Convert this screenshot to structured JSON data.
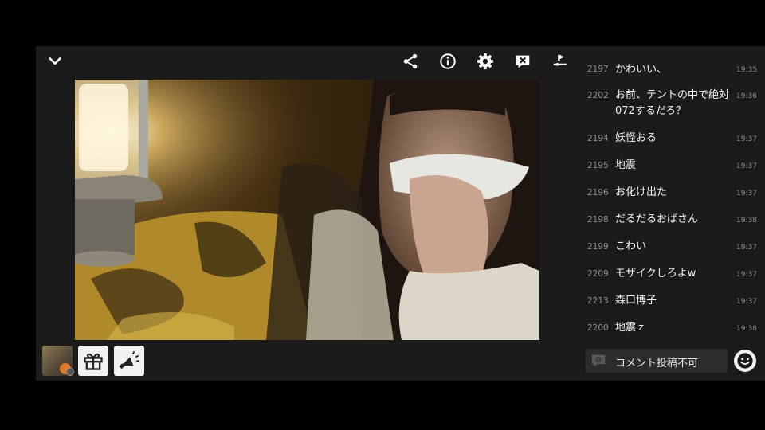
{
  "toolbar": {
    "collapse_icon": "chevron-down-icon",
    "share_icon": "share-icon",
    "info_icon": "info-icon",
    "settings_icon": "gear-icon",
    "close_icon": "close-box-icon",
    "exit_icon": "exit-icon"
  },
  "comments": [
    {
      "num": "2197",
      "text": "かわいい、",
      "time": "19:35"
    },
    {
      "num": "2202",
      "text": "お前、テントの中で絶対072するだろ？",
      "time": "19:36"
    },
    {
      "num": "2194",
      "text": "妖怪おる",
      "time": "19:37"
    },
    {
      "num": "2195",
      "text": "地震",
      "time": "19:37"
    },
    {
      "num": "2196",
      "text": "お化け出た",
      "time": "19:37"
    },
    {
      "num": "2198",
      "text": "だるだるおばさん",
      "time": "19:38"
    },
    {
      "num": "2199",
      "text": "こわい",
      "time": "19:37"
    },
    {
      "num": "2209",
      "text": "モザイクしろよw",
      "time": "19:37"
    },
    {
      "num": "2213",
      "text": "森口博子",
      "time": "19:37"
    },
    {
      "num": "2200",
      "text": "地震ｚ",
      "time": "19:38"
    }
  ],
  "comment_input": {
    "status": "コメント投稿不可"
  },
  "bottom": {
    "gift_icon": "gift-icon",
    "announce_icon": "megaphone-icon",
    "emoji_icon": "smiley-icon"
  }
}
